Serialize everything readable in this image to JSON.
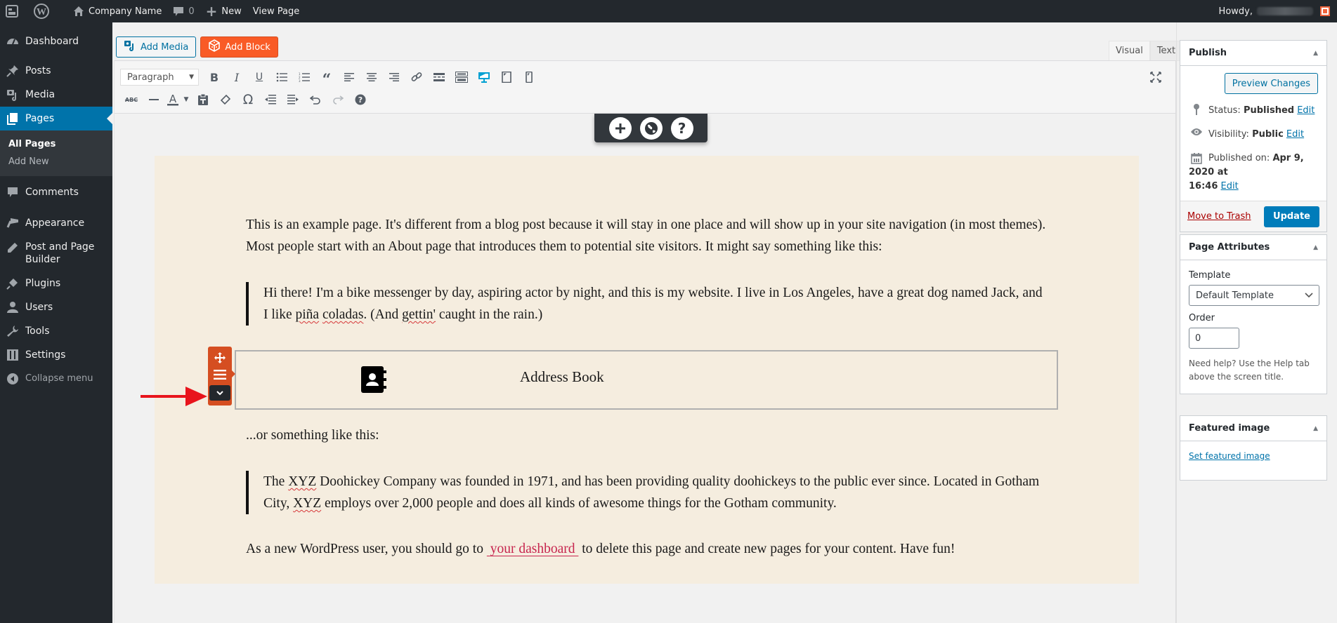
{
  "adminbar": {
    "site_name": "Company Name",
    "comments_count": "0",
    "new_label": "New",
    "view_page_label": "View Page",
    "howdy_label": "Howdy,"
  },
  "sidebar": {
    "items": [
      {
        "label": "Dashboard",
        "icon": "dashboard-icon"
      },
      {
        "label": "Posts",
        "icon": "pin-icon"
      },
      {
        "label": "Media",
        "icon": "media-icon"
      },
      {
        "label": "Pages",
        "icon": "pages-icon"
      },
      {
        "label": "Comments",
        "icon": "comment-icon"
      },
      {
        "label": "Appearance",
        "icon": "brush-icon"
      },
      {
        "label": "Post and Page Builder",
        "icon": "pencil-icon"
      },
      {
        "label": "Plugins",
        "icon": "plug-icon"
      },
      {
        "label": "Users",
        "icon": "user-icon"
      },
      {
        "label": "Tools",
        "icon": "wrench-icon"
      },
      {
        "label": "Settings",
        "icon": "sliders-icon"
      },
      {
        "label": "Collapse menu",
        "icon": "collapse-icon"
      }
    ],
    "submenu": [
      {
        "label": "All Pages"
      },
      {
        "label": "Add New"
      }
    ]
  },
  "editor": {
    "add_media_label": "Add Media",
    "add_block_label": "Add Block",
    "tabs": [
      {
        "label": "Visual"
      },
      {
        "label": "Text"
      }
    ],
    "format_select": "Paragraph"
  },
  "content": {
    "p1": "This is an example page. It's different from a blog post because it will stay in one place and will show up in your site navigation (in most themes). Most people start with an About page that introduces them to potential site visitors. It might say something like this:",
    "q1_a": "Hi there! I'm a bike messenger by day, aspiring actor by night, and this is my website. I live in Los Angeles, have a great dog named Jack, and I like ",
    "q1_w1": "piña",
    "q1_w2": "coladas",
    "q1_b": ". (And ",
    "q1_w3": "gettin'",
    "q1_c": " caught in the rain.)",
    "address_block_title": "Address Book",
    "p2": "...or something like this:",
    "q2_a": "The ",
    "q2_w1": "XYZ",
    "q2_b": " Doohickey Company was founded in 1971, and has been providing quality doohickeys to the public ever since. Located in Gotham City, ",
    "q2_w2": "XYZ",
    "q2_c": " employs over 2,000 people and does all kinds of awesome things for the Gotham community.",
    "p3_a": "As a new WordPress user, you should go to ",
    "p3_link": "your dashboard",
    "p3_b": " to delete this page and create new pages for your content. Have fun!"
  },
  "publish": {
    "title": "Publish",
    "preview_label": "Preview Changes",
    "status_label": "Status:",
    "status_value": "Published",
    "visibility_label": "Visibility:",
    "visibility_value": "Public",
    "published_on_label": "Published on:",
    "published_on_value": "Apr 9, 2020 at",
    "published_time": "16:46",
    "edit_label": "Edit",
    "trash_label": "Move to Trash",
    "update_label": "Update"
  },
  "page_attributes": {
    "title": "Page Attributes",
    "template_label": "Template",
    "template_value": "Default Template",
    "order_label": "Order",
    "order_value": "0",
    "help_text": "Need help? Use the Help tab above the screen title."
  },
  "featured_image": {
    "title": "Featured image",
    "set_label": "Set featured image"
  },
  "colors": {
    "admin_dark": "#23282d",
    "admin_blue": "#0073aa",
    "builder_orange": "#f95b26",
    "row_handle": "#d54e21",
    "content_bg": "#f5eddf",
    "link_red": "#c7254e",
    "annotation_arrow": "#e8141c"
  }
}
